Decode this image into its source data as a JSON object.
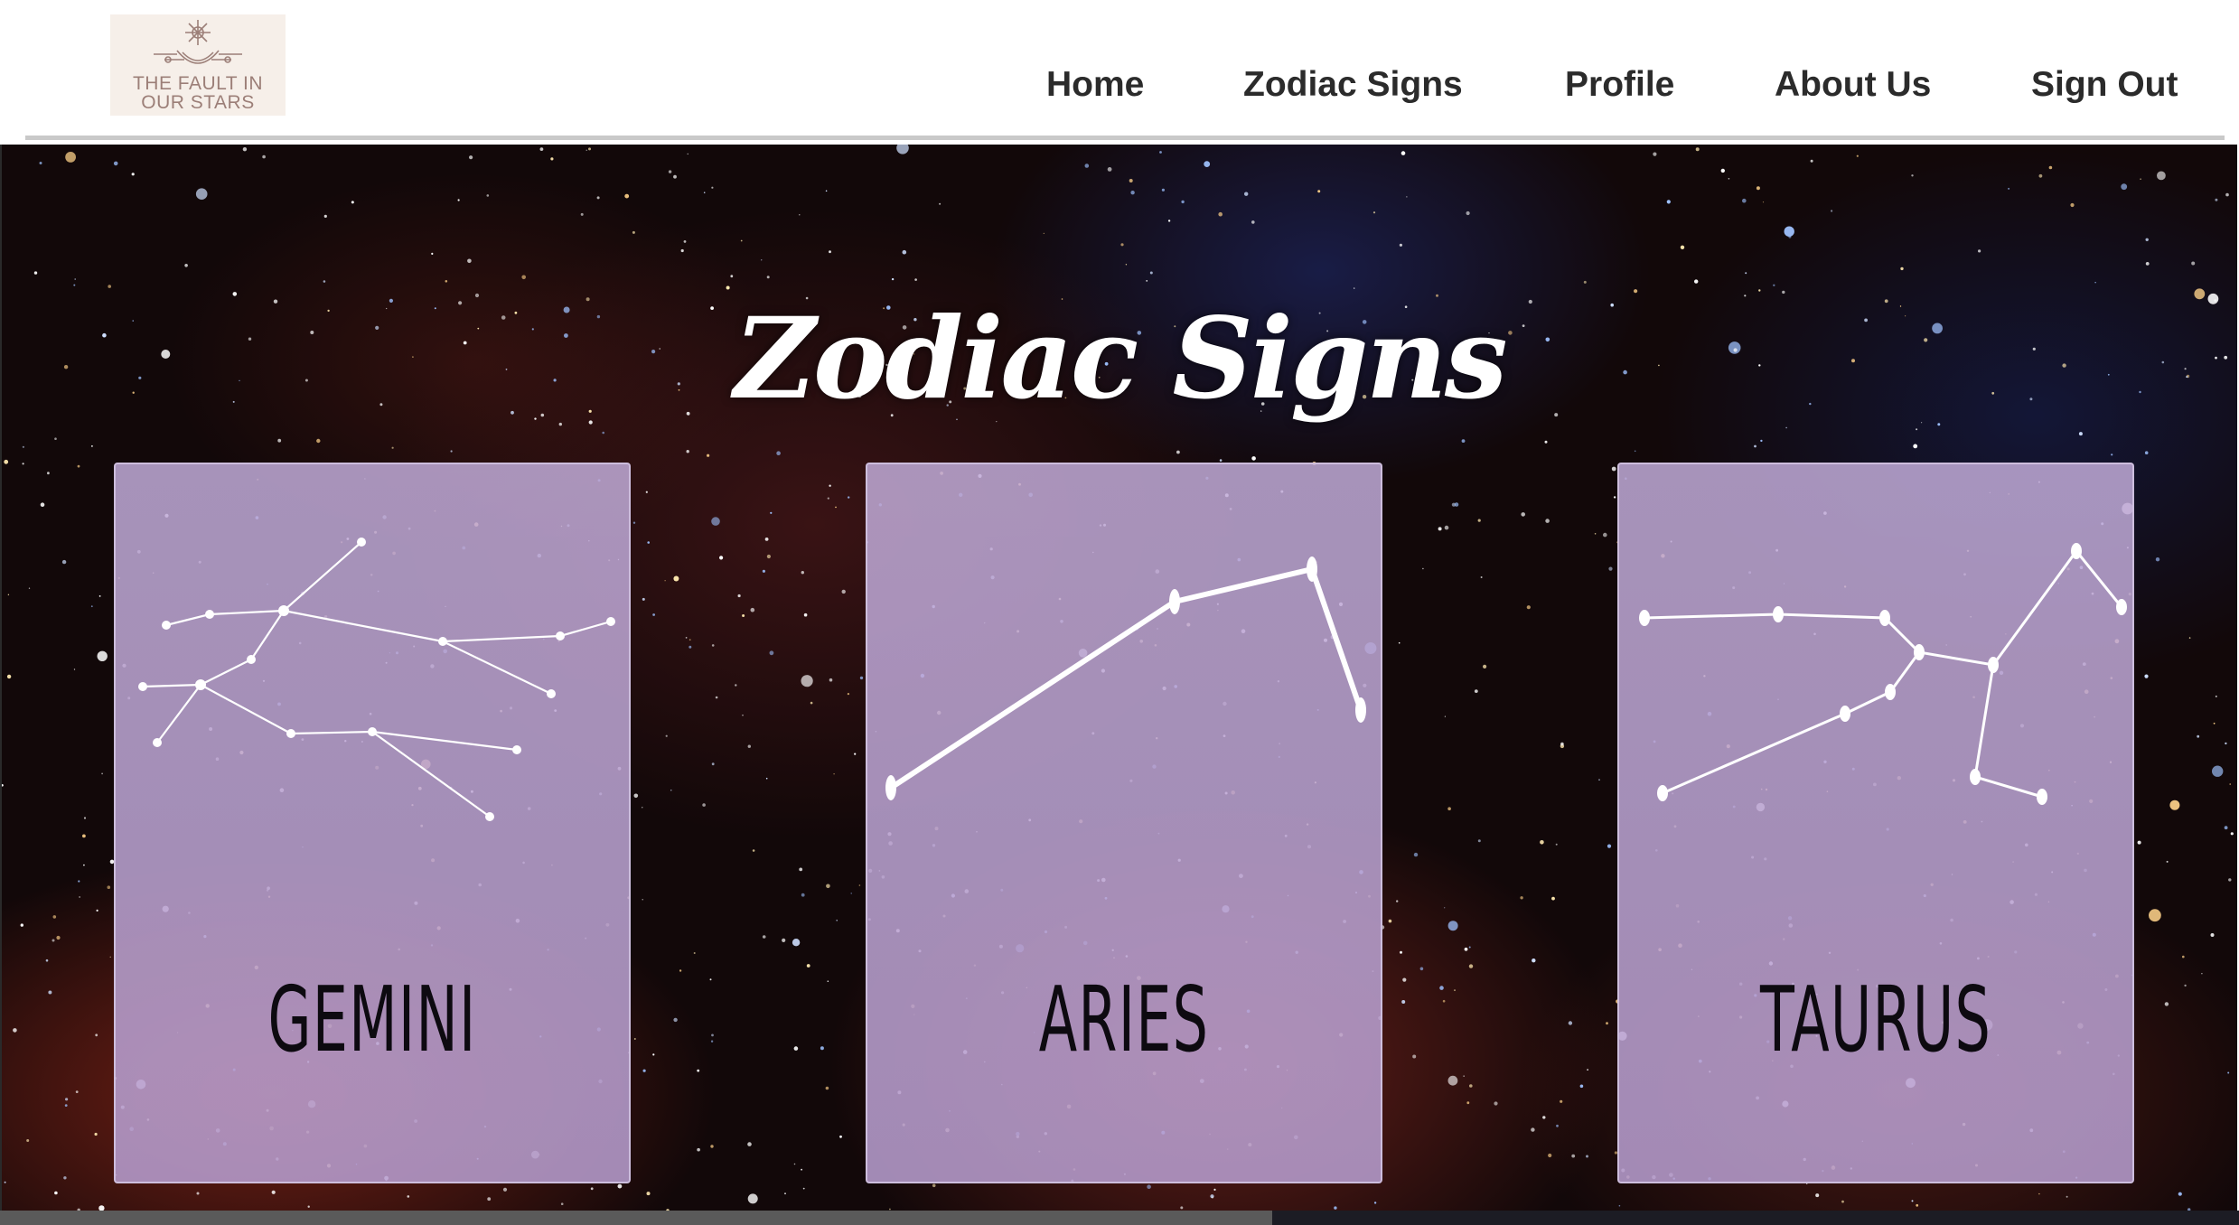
{
  "logo": {
    "line1": "THE FAULT IN",
    "line2": "OUR STARS",
    "icon": "moon-sun-logo-icon"
  },
  "nav": [
    {
      "label": "Home"
    },
    {
      "label": "Zodiac Signs"
    },
    {
      "label": "Profile"
    },
    {
      "label": "About Us"
    },
    {
      "label": "Sign Out"
    }
  ],
  "main": {
    "title": "Zodiac Signs",
    "cards": [
      {
        "label": "GEMINI",
        "icon": "gemini-constellation-icon"
      },
      {
        "label": "ARIES",
        "icon": "aries-constellation-icon"
      },
      {
        "label": "TAURUS",
        "icon": "taurus-constellation-icon"
      }
    ]
  },
  "colors": {
    "nav_text": "#2b2b2b",
    "card_fill": "#b9a0cf",
    "title_text": "#ffffff",
    "label_text": "#0d0a10"
  }
}
